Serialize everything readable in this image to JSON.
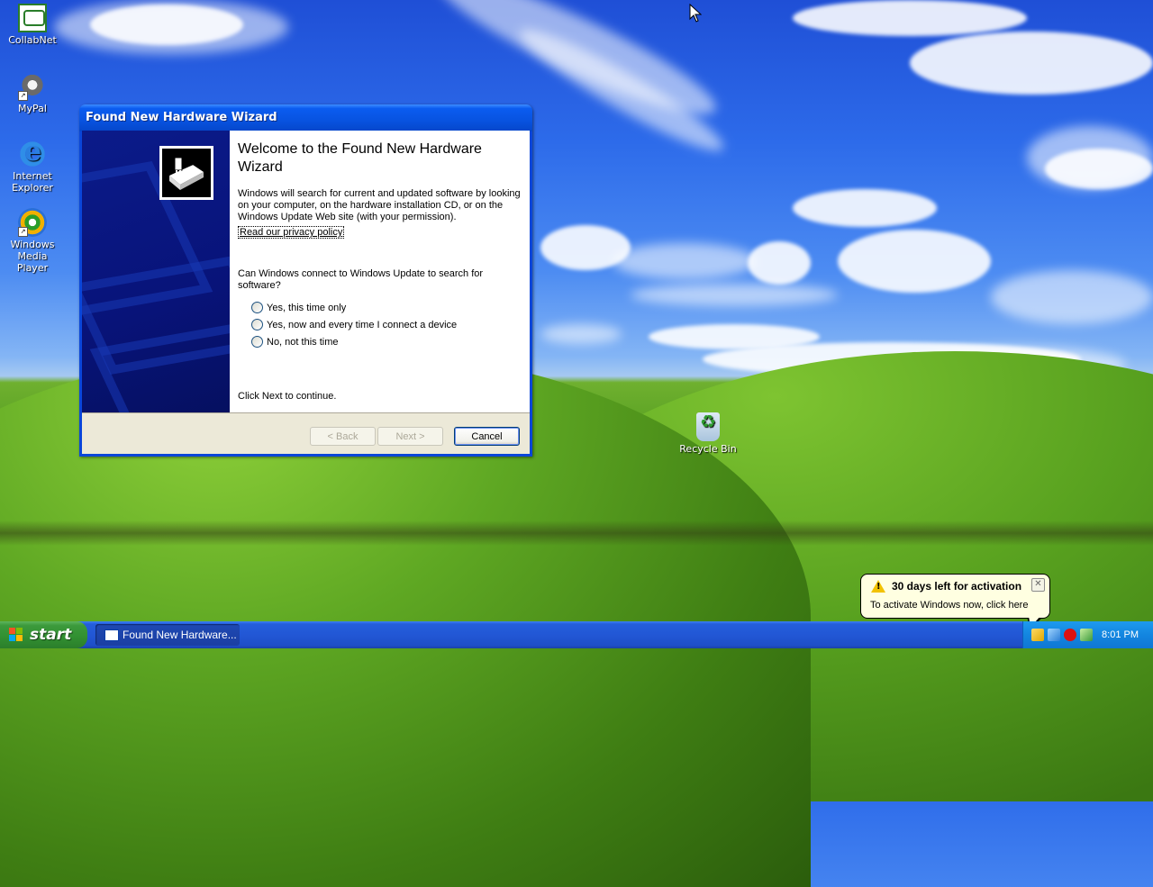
{
  "desktop": {
    "icons": [
      {
        "label": "CollabNet"
      },
      {
        "label": "MyPal"
      },
      {
        "label": "Internet Explorer"
      },
      {
        "label": "Windows Media Player"
      },
      {
        "label": "Recycle Bin"
      }
    ]
  },
  "wizard": {
    "title": "Found New Hardware Wizard",
    "heading": "Welcome to the Found New Hardware Wizard",
    "description": "Windows will search for current and updated software by looking on your computer, on the hardware installation CD, or on the Windows Update Web site (with your permission).",
    "privacy_link": "Read our privacy policy",
    "question": "Can Windows connect to Windows Update to search for software?",
    "options": [
      {
        "label": "Yes, this time only",
        "selected": false
      },
      {
        "label": "Yes, now and every time I connect a device",
        "selected": false
      },
      {
        "label": "No, not this time",
        "selected": false
      }
    ],
    "instruction": "Click Next to continue.",
    "buttons": {
      "back": "< Back",
      "next": "Next >",
      "cancel": "Cancel"
    }
  },
  "taskbar": {
    "start_label": "start",
    "task_button": "Found New Hardware...",
    "clock": "8:01 PM"
  },
  "balloon": {
    "title": "30 days left for activation",
    "text": "To activate Windows now, click here"
  },
  "colors": {
    "titlebar": "#0853e0",
    "wizard_side": "#081379",
    "taskbar": "#245edb",
    "start_button": "#3c9a3c",
    "balloon_bg": "#ffffe1"
  }
}
